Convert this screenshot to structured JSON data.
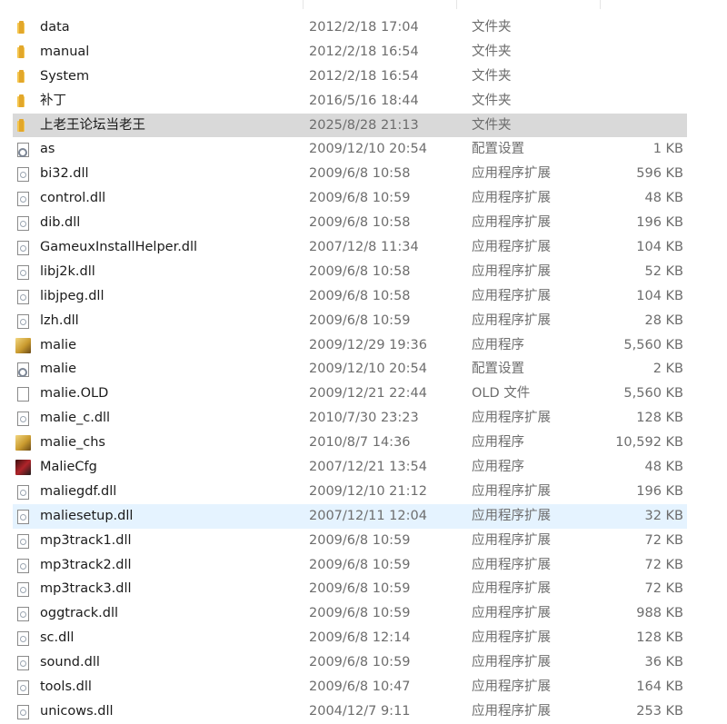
{
  "colors": {
    "selected_row": "#d9d9d9",
    "hover_row": "#e5f3ff",
    "folder": "#f5c64f",
    "secondary_text": "#6d6d6d"
  },
  "files": [
    {
      "name": "data",
      "date": "2012/2/18 17:04",
      "type": "文件夹",
      "size": "",
      "icon": "folder-icon"
    },
    {
      "name": "manual",
      "date": "2012/2/18 16:54",
      "type": "文件夹",
      "size": "",
      "icon": "folder-icon"
    },
    {
      "name": "System",
      "date": "2012/2/18 16:54",
      "type": "文件夹",
      "size": "",
      "icon": "folder-icon"
    },
    {
      "name": "补丁",
      "date": "2016/5/16 18:44",
      "type": "文件夹",
      "size": "",
      "icon": "folder-icon"
    },
    {
      "name": "上老王论坛当老王",
      "date": "2025/8/28 21:13",
      "type": "文件夹",
      "size": "",
      "icon": "folder-icon",
      "state": "selected"
    },
    {
      "name": "as",
      "date": "2009/12/10 20:54",
      "type": "配置设置",
      "size": "1 KB",
      "icon": "config-icon"
    },
    {
      "name": "bi32.dll",
      "date": "2009/6/8 10:58",
      "type": "应用程序扩展",
      "size": "596 KB",
      "icon": "doc-icon"
    },
    {
      "name": "control.dll",
      "date": "2009/6/8 10:59",
      "type": "应用程序扩展",
      "size": "48 KB",
      "icon": "doc-icon"
    },
    {
      "name": "dib.dll",
      "date": "2009/6/8 10:58",
      "type": "应用程序扩展",
      "size": "196 KB",
      "icon": "doc-icon"
    },
    {
      "name": "GameuxInstallHelper.dll",
      "date": "2007/12/8 11:34",
      "type": "应用程序扩展",
      "size": "104 KB",
      "icon": "doc-icon"
    },
    {
      "name": "libj2k.dll",
      "date": "2009/6/8 10:58",
      "type": "应用程序扩展",
      "size": "52 KB",
      "icon": "doc-icon"
    },
    {
      "name": "libjpeg.dll",
      "date": "2009/6/8 10:58",
      "type": "应用程序扩展",
      "size": "104 KB",
      "icon": "doc-icon"
    },
    {
      "name": "lzh.dll",
      "date": "2009/6/8 10:59",
      "type": "应用程序扩展",
      "size": "28 KB",
      "icon": "doc-icon"
    },
    {
      "name": "malie",
      "date": "2009/12/29 19:36",
      "type": "应用程序",
      "size": "5,560 KB",
      "icon": "app-icon"
    },
    {
      "name": "malie",
      "date": "2009/12/10 20:54",
      "type": "配置设置",
      "size": "2 KB",
      "icon": "config-icon"
    },
    {
      "name": "malie.OLD",
      "date": "2009/12/21 22:44",
      "type": "OLD 文件",
      "size": "5,560 KB",
      "icon": "blank-icon"
    },
    {
      "name": "malie_c.dll",
      "date": "2010/7/30 23:23",
      "type": "应用程序扩展",
      "size": "128 KB",
      "icon": "doc-icon"
    },
    {
      "name": "malie_chs",
      "date": "2010/8/7 14:36",
      "type": "应用程序",
      "size": "10,592 KB",
      "icon": "app-icon"
    },
    {
      "name": "MalieCfg",
      "date": "2007/12/21 13:54",
      "type": "应用程序",
      "size": "48 KB",
      "icon": "cfg-icon"
    },
    {
      "name": "maliegdf.dll",
      "date": "2009/12/10 21:12",
      "type": "应用程序扩展",
      "size": "196 KB",
      "icon": "doc-icon"
    },
    {
      "name": "maliesetup.dll",
      "date": "2007/12/11 12:04",
      "type": "应用程序扩展",
      "size": "32 KB",
      "icon": "doc-icon",
      "state": "hover"
    },
    {
      "name": "mp3track1.dll",
      "date": "2009/6/8 10:59",
      "type": "应用程序扩展",
      "size": "72 KB",
      "icon": "doc-icon"
    },
    {
      "name": "mp3track2.dll",
      "date": "2009/6/8 10:59",
      "type": "应用程序扩展",
      "size": "72 KB",
      "icon": "doc-icon"
    },
    {
      "name": "mp3track3.dll",
      "date": "2009/6/8 10:59",
      "type": "应用程序扩展",
      "size": "72 KB",
      "icon": "doc-icon"
    },
    {
      "name": "oggtrack.dll",
      "date": "2009/6/8 10:59",
      "type": "应用程序扩展",
      "size": "988 KB",
      "icon": "doc-icon"
    },
    {
      "name": "sc.dll",
      "date": "2009/6/8 12:14",
      "type": "应用程序扩展",
      "size": "128 KB",
      "icon": "doc-icon"
    },
    {
      "name": "sound.dll",
      "date": "2009/6/8 10:59",
      "type": "应用程序扩展",
      "size": "36 KB",
      "icon": "doc-icon"
    },
    {
      "name": "tools.dll",
      "date": "2009/6/8 10:47",
      "type": "应用程序扩展",
      "size": "164 KB",
      "icon": "doc-icon"
    },
    {
      "name": "unicows.dll",
      "date": "2004/12/7 9:11",
      "type": "应用程序扩展",
      "size": "253 KB",
      "icon": "doc-icon"
    }
  ]
}
